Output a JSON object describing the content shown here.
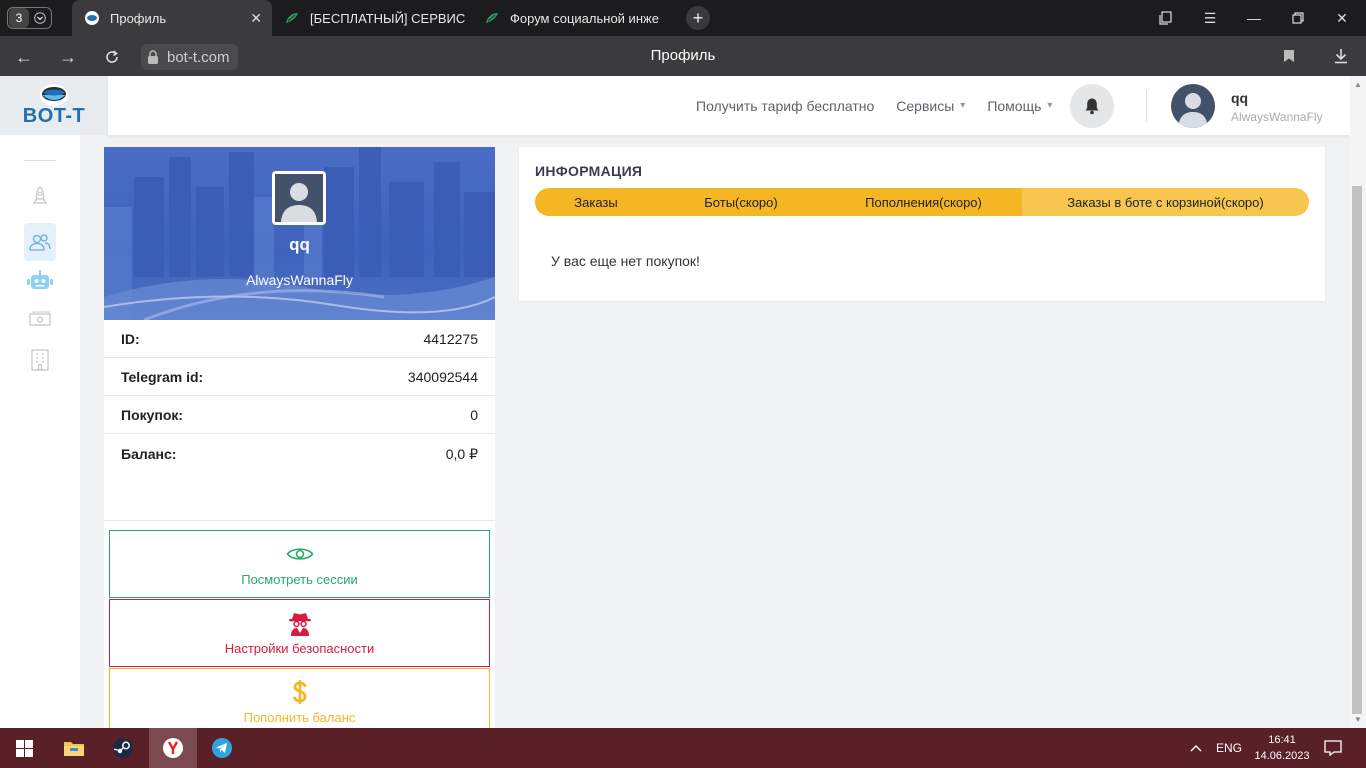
{
  "browser": {
    "tab_count": "3",
    "tabs": [
      {
        "title": "Профиль",
        "active": true
      },
      {
        "title": "[БЕСПЛАТНЫЙ] СЕРВИС Д",
        "active": false
      },
      {
        "title": "Форум социальной инже",
        "active": false
      }
    ],
    "url": "bot-t.com",
    "page_title": "Профиль"
  },
  "header": {
    "logo": "BOT-T",
    "nav": [
      {
        "label": "Получить тариф бесплатно",
        "has_dropdown": false
      },
      {
        "label": "Сервисы",
        "has_dropdown": true
      },
      {
        "label": "Помощь",
        "has_dropdown": true
      }
    ],
    "user": {
      "name": "qq",
      "login": "AlwaysWannaFly"
    }
  },
  "profile": {
    "name": "qq",
    "login": "AlwaysWannaFly",
    "rows": [
      {
        "key": "ID:",
        "value": "4412275"
      },
      {
        "key": "Telegram id:",
        "value": "340092544"
      },
      {
        "key": "Покупок:",
        "value": "0"
      },
      {
        "key": "Баланс:",
        "value": "0,0 ₽"
      }
    ],
    "actions": [
      {
        "label": "Посмотреть сессии",
        "color": "#28a86b",
        "icon": "eye-icon"
      },
      {
        "label": "Настройки безопасности",
        "color": "#d81b40",
        "icon": "spy-icon"
      },
      {
        "label": "Пополнить баланс",
        "color": "#f5b623",
        "icon": "dollar-icon"
      }
    ]
  },
  "info": {
    "title": "ИНФОРМАЦИЯ",
    "tabs": [
      {
        "label": "Заказы",
        "active": true
      },
      {
        "label": "Боты(скоро)",
        "active": true
      },
      {
        "label": "Пополнения(скоро)",
        "active": true
      },
      {
        "label": "Заказы в боте с корзиной(скоро)",
        "active": false
      }
    ],
    "empty_message": "У вас еще нет покупок!"
  },
  "taskbar": {
    "language": "ENG",
    "time": "16:41",
    "date": "14.06.2023"
  },
  "colors": {
    "accent_yellow": "#f5b623",
    "accent_yellow_light": "#f7c64f",
    "hero_blue": "#4467c2"
  }
}
